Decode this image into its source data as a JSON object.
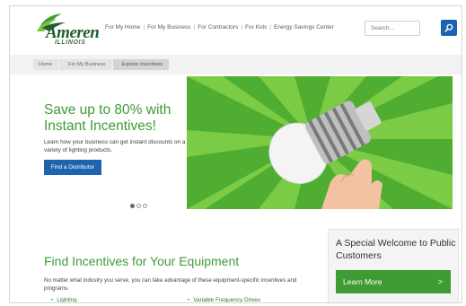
{
  "brand": {
    "name": "Ameren",
    "region": "ILLINOIS",
    "colors": {
      "green": "#3d9c35",
      "blue": "#1d63ad"
    }
  },
  "nav": {
    "items": [
      {
        "label": "For My Home"
      },
      {
        "label": "For My Business"
      },
      {
        "label": "For Contractors"
      },
      {
        "label": "For Kids"
      },
      {
        "label": "Energy Savings Center"
      }
    ],
    "separator": "|"
  },
  "search": {
    "placeholder": "Search...",
    "icon": "search-icon"
  },
  "breadcrumb": [
    {
      "label": "Home"
    },
    {
      "label": "For My Business"
    },
    {
      "label": "Explore Incentives"
    }
  ],
  "hero": {
    "title": "Save up to 80% with Instant Incentives!",
    "text": "Learn how your business can get instant discounts on a variety of lighting products.",
    "button_label": "Find a Distributor",
    "image": "hand-holding-led-bulb-image",
    "slides_total": 3,
    "slides_active": 1
  },
  "incentives": {
    "title": "Find Incentives for Your Equipment",
    "text": "No matter what industry you serve, you can take advantage of these equipment-specific incentives and programs.",
    "left_items": [
      "Lighting"
    ],
    "right_items": [
      "Variable Frequency Drives"
    ]
  },
  "welcome": {
    "title": "A Special Welcome to Public Customers",
    "button_label": "Learn More",
    "button_icon": ">"
  }
}
